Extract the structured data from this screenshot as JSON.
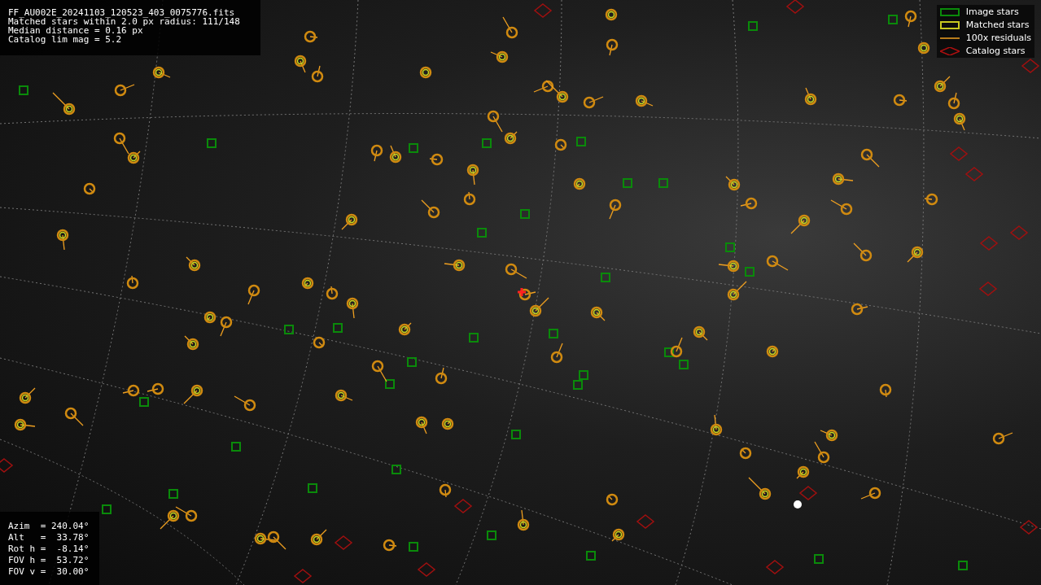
{
  "info_lines": [
    "FF_AU002E_20241103_120523_403_0075776.fits",
    "Matched stars within 2.0 px radius: 111/148",
    "Median distance = 0.16 px",
    "Catalog lim mag = 5.2"
  ],
  "legend": [
    {
      "kind": "image",
      "label": "Image stars"
    },
    {
      "kind": "matched",
      "label": "Matched stars"
    },
    {
      "kind": "residual",
      "label": "100x residuals"
    },
    {
      "kind": "catalog",
      "label": "Catalog stars"
    }
  ],
  "pointing": [
    "Azim  = 240.04°",
    "Alt   =  33.78°",
    "Rot h =  -8.14°",
    "FOV h =  53.72°",
    "FOV v =  30.00°"
  ]
}
